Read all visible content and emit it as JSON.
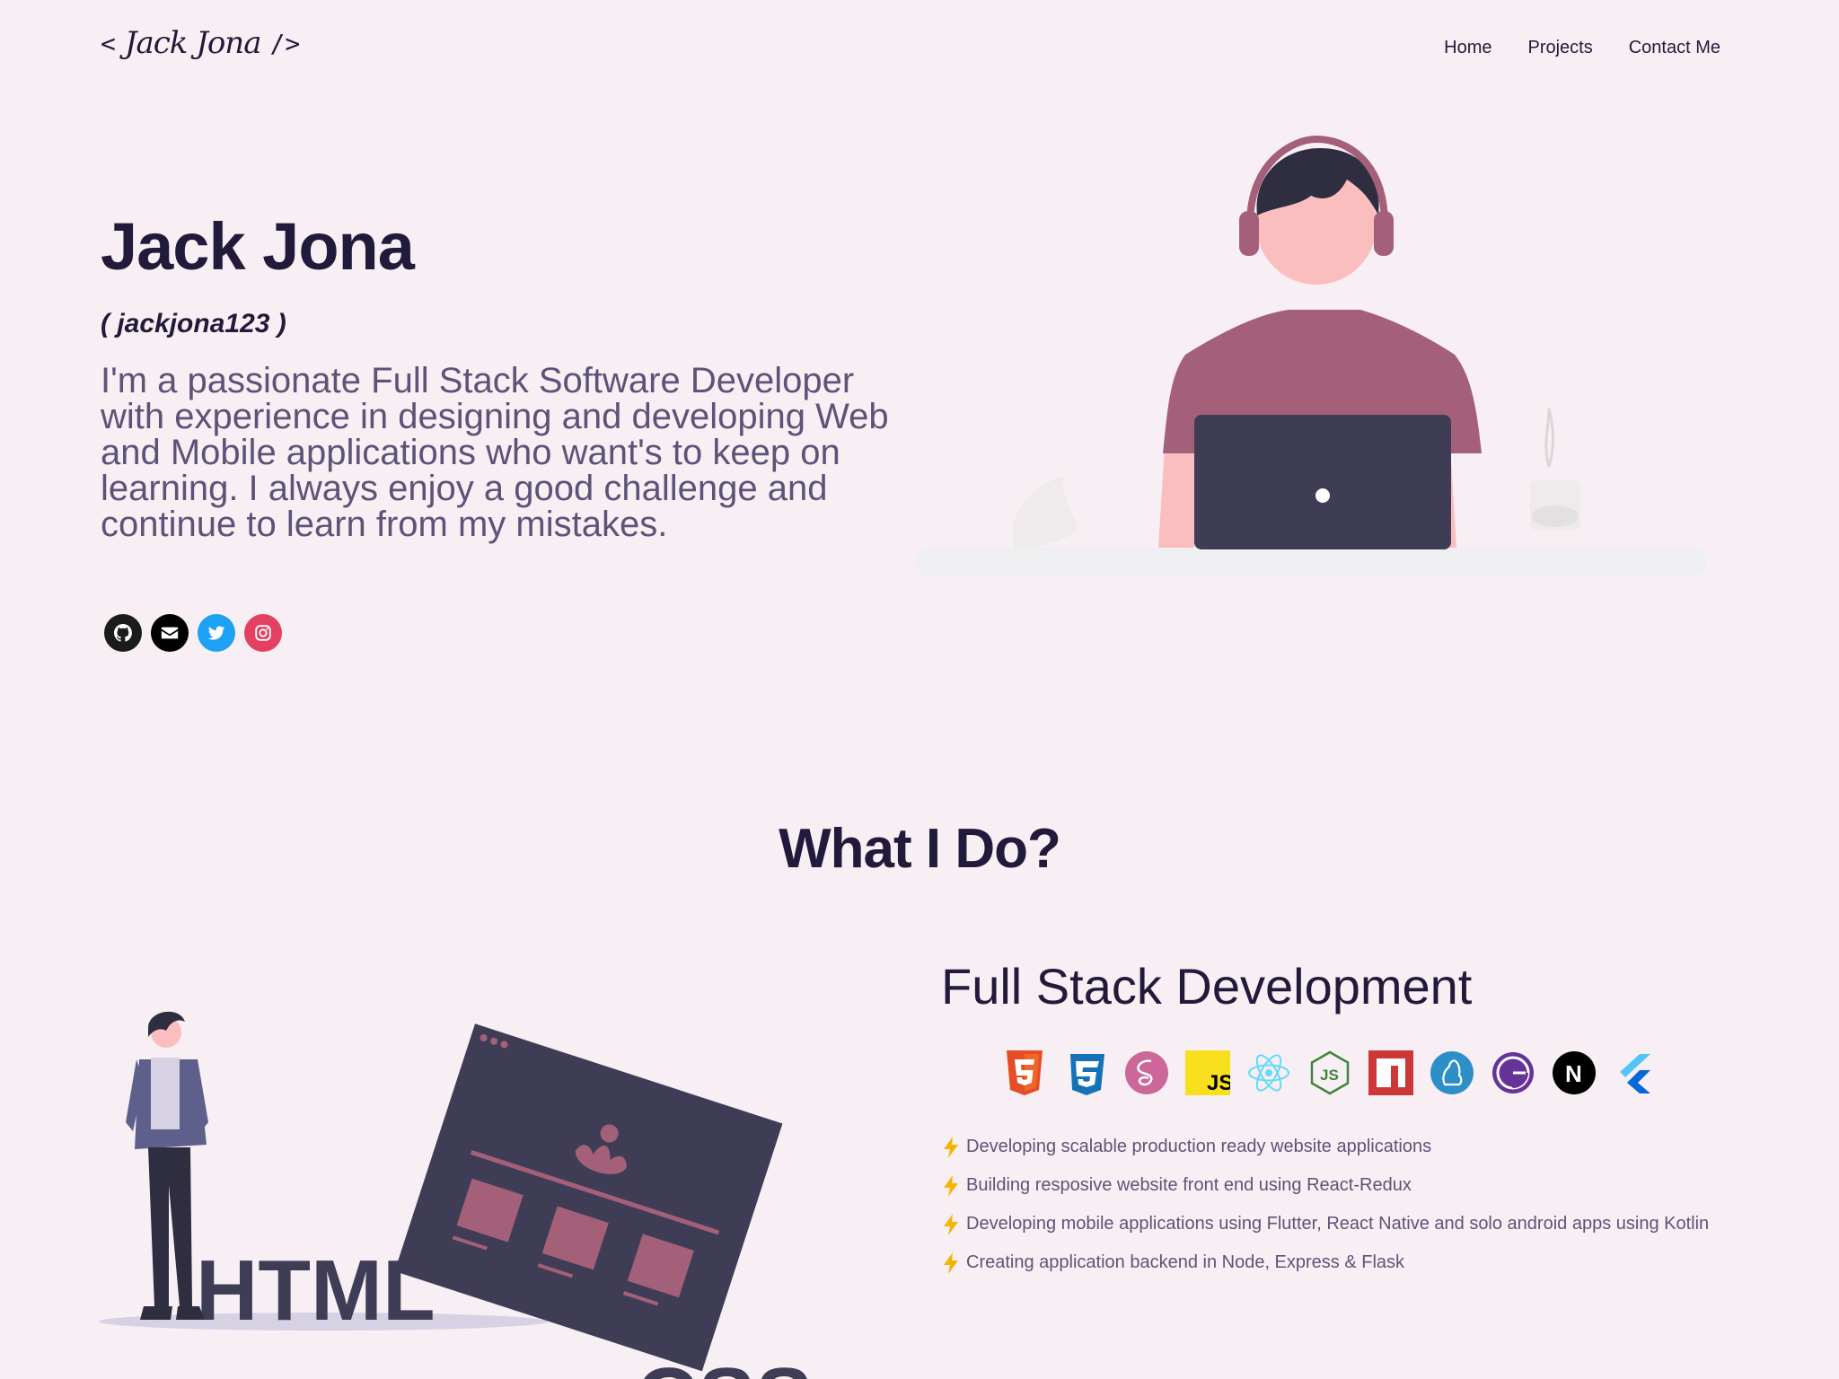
{
  "header": {
    "logo_open": "<",
    "logo_signature": "Jack Jona",
    "logo_close": "/>",
    "nav": [
      {
        "label": "Home"
      },
      {
        "label": "Projects"
      },
      {
        "label": "Contact Me"
      }
    ]
  },
  "hero": {
    "name": "Jack Jona",
    "handle": "( jackjona123 )",
    "bio": "I'm a passionate Full Stack Software Developer with experience in designing and developing Web and Mobile applications who want's to keep on learning. I always enjoy a good challenge and continue to learn from my mistakes.",
    "socials": [
      {
        "icon": "github-icon",
        "color": "#1b1b1b"
      },
      {
        "icon": "mail-icon",
        "color": "#000000"
      },
      {
        "icon": "twitter-icon",
        "color": "#1da1f2"
      },
      {
        "icon": "instagram-icon",
        "color": "#e4405f"
      }
    ]
  },
  "what_i_do": {
    "title": "What I Do?",
    "skill_title": "Full Stack Development",
    "illustration_words": [
      "HTML",
      "CSS"
    ],
    "tech_icons": [
      {
        "icon": "html5-icon",
        "color": "#e44d26"
      },
      {
        "icon": "css3-icon",
        "color": "#1572b6"
      },
      {
        "icon": "sass-icon",
        "color": "#cd6799"
      },
      {
        "icon": "javascript-icon",
        "color": "#f7df1e",
        "label": "JS"
      },
      {
        "icon": "react-icon",
        "color": "#61dafb"
      },
      {
        "icon": "nodejs-icon",
        "color": "#3c873a",
        "label": "JS"
      },
      {
        "icon": "npm-icon",
        "color": "#cb3837"
      },
      {
        "icon": "firebase-icon",
        "color": "#2d8fc7"
      },
      {
        "icon": "gatsby-icon",
        "color": "#663399",
        "label": "G"
      },
      {
        "icon": "nextjs-icon",
        "color": "#000000",
        "label": "N"
      },
      {
        "icon": "flutter-icon",
        "color": "#0468d7"
      }
    ],
    "bullets": [
      "Developing scalable production ready website applications",
      "Building resposive website front end using React-Redux",
      "Developing mobile applications using Flutter, React Native and solo android apps using Kotlin",
      "Creating application backend in Node, Express & Flask"
    ]
  },
  "colors": {
    "background": "#f8eff4",
    "heading": "#221a3b",
    "body_text": "#5c5478",
    "accent": "#a56079",
    "illustration_dark": "#3f3d56",
    "bolt": "#f5b400"
  }
}
